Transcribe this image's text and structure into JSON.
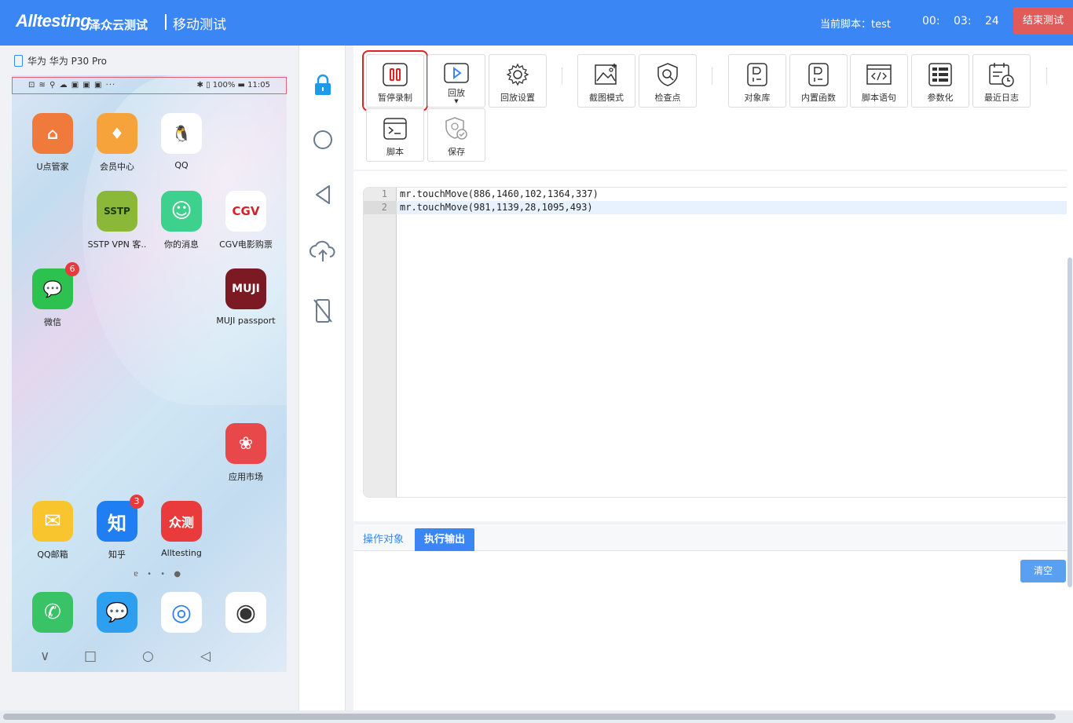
{
  "header": {
    "logo_text": "Alltesting",
    "logo_cn": "泽众云测试",
    "module_title": "移动测试",
    "current_script_label": "当前脚本：test",
    "timer": {
      "h": "00:",
      "m": "03:",
      "s": "24"
    },
    "end_button": "结束测试"
  },
  "device": {
    "name": "华为 华为 P30 Pro",
    "status_left": "⊡ ≋ ⚲ ☁ ▣ ▣ ▣ ···",
    "status_right": "✱ ▯ 100% ▬ 11:05",
    "apps": [
      {
        "label": "U点管家",
        "color": "#f07a3c",
        "glyph": "⌂"
      },
      {
        "label": "会员中心",
        "color": "#f5a33a",
        "glyph": "♦"
      },
      {
        "label": "QQ",
        "color": "#ffffff",
        "glyph": "🐧"
      },
      {
        "label": "SSTP VPN 客..",
        "color": "#8cb83a",
        "glyph": "SSTP"
      },
      {
        "label": "你的消息",
        "color": "#3ed18d",
        "glyph": "☺"
      },
      {
        "label": "CGV电影购票",
        "color": "#ffffff",
        "glyph": "CGV"
      },
      {
        "label": "微信",
        "color": "#2dc14f",
        "glyph": "💬",
        "badge": "6"
      },
      {
        "label": "MUJI passport",
        "color": "#7b1a22",
        "glyph": "MUJI"
      },
      {
        "label": "应用市场",
        "color": "#e8484a",
        "glyph": "❀"
      },
      {
        "label": "QQ邮箱",
        "color": "#f9c52e",
        "glyph": "✉"
      },
      {
        "label": "知乎",
        "color": "#1f7ff2",
        "glyph": "知",
        "badge": "3"
      },
      {
        "label": "Alltesting",
        "color": "#e93b3b",
        "glyph": "众测"
      }
    ],
    "dock": [
      {
        "color": "#3ac266",
        "glyph": "✆"
      },
      {
        "color": "#2d9ff1",
        "glyph": "💬"
      },
      {
        "color": "#ffffff",
        "glyph": "◎"
      },
      {
        "color": "#ffffff",
        "glyph": "◉"
      }
    ],
    "page_dots": "ɐ • • ●",
    "nav": {
      "back": "∨",
      "home": "□",
      "circle": "○",
      "tri": "◁"
    }
  },
  "side_tools": [
    "lock-icon",
    "circle-icon",
    "back-triangle-icon",
    "cloud-upload-icon",
    "phone-off-icon"
  ],
  "toolbar": {
    "pause_record": "暂停录制",
    "playback": "回放",
    "playback_settings": "回放设置",
    "screenshot_mode": "截图模式",
    "checkpoint": "检查点",
    "object_library": "对象库",
    "builtin_functions": "内置函数",
    "script_statements": "脚本语句",
    "parameterize": "参数化",
    "recent_logs": "最近日志",
    "script": "脚本",
    "save": "保存"
  },
  "editor": {
    "lines": [
      {
        "no": "1",
        "text": "mr.touchMove(886,1460,102,1364,337)"
      },
      {
        "no": "2",
        "text": "mr.touchMove(981,1139,28,1095,493)"
      }
    ]
  },
  "output": {
    "tab_objects": "操作对象",
    "tab_output": "执行输出",
    "clear_button": "清空"
  },
  "colors": {
    "accent": "#3a86f5",
    "danger": "#e25b5b",
    "record": "#e02424"
  }
}
